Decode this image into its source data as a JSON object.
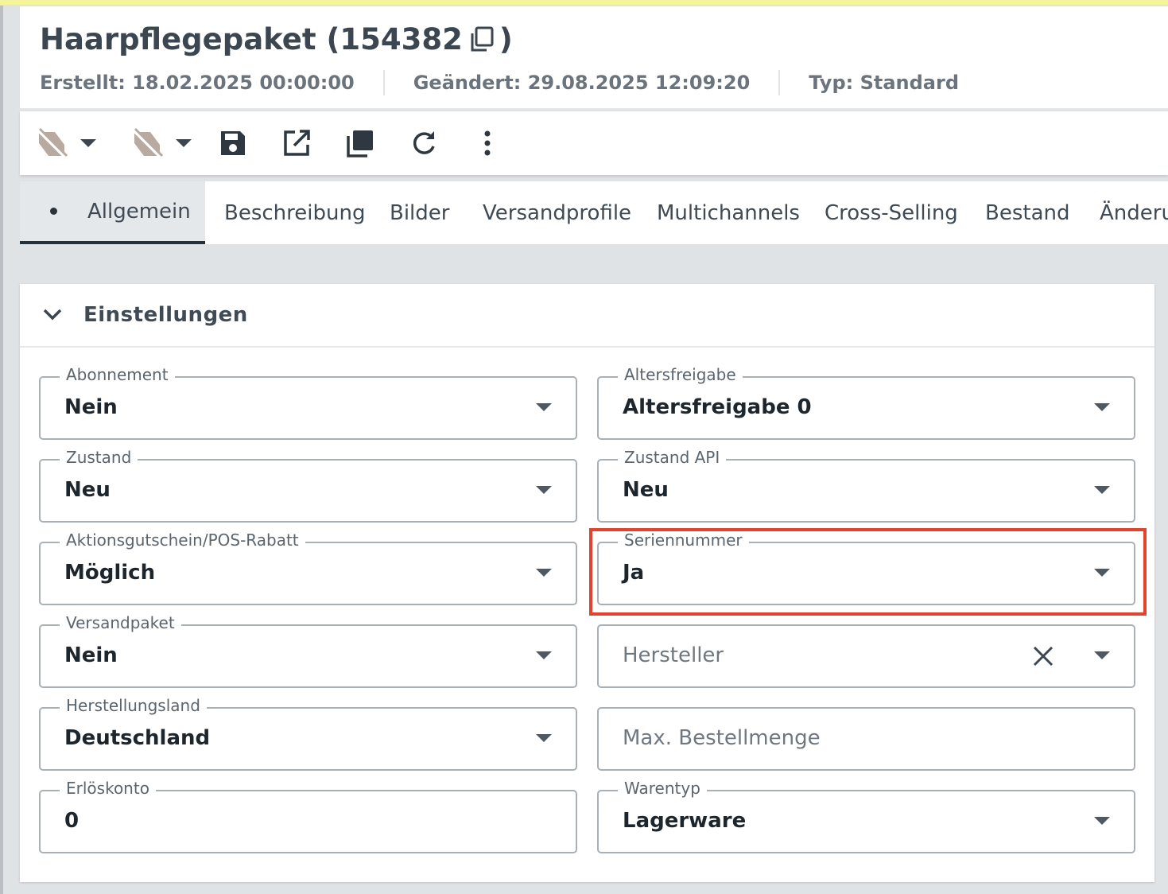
{
  "header": {
    "title": "Haarpflegepaket (154382",
    "title_close": ")",
    "created": "Erstellt: 18.02.2025 00:00:00",
    "modified": "Geändert: 29.08.2025 12:09:20",
    "type": "Typ: Standard"
  },
  "toolbar": {
    "icons": [
      "visibility-off-icon",
      "visibility-off-icon",
      "save-icon",
      "open-external-icon",
      "duplicate-icon",
      "refresh-icon",
      "more-vertical-icon"
    ]
  },
  "tabs": [
    {
      "label": "Allgemein",
      "active": true
    },
    {
      "label": "Beschreibung"
    },
    {
      "label": "Bilder"
    },
    {
      "label": "Versandprofile"
    },
    {
      "label": "Multichannels"
    },
    {
      "label": "Cross-Selling"
    },
    {
      "label": "Bestand"
    },
    {
      "label": "Änderu"
    }
  ],
  "section": {
    "title": "Einstellungen"
  },
  "fields": {
    "abonnement": {
      "label": "Abonnement",
      "value": "Nein"
    },
    "altersfreigabe": {
      "label": "Altersfreigabe",
      "value": "Altersfreigabe 0"
    },
    "zustand": {
      "label": "Zustand",
      "value": "Neu"
    },
    "zustand_api": {
      "label": "Zustand API",
      "value": "Neu"
    },
    "aktionsgutschein": {
      "label": "Aktionsgutschein/POS-Rabatt",
      "value": "Möglich"
    },
    "seriennummer": {
      "label": "Seriennummer",
      "value": "Ja"
    },
    "versandpaket": {
      "label": "Versandpaket",
      "value": "Nein"
    },
    "hersteller": {
      "placeholder": "Hersteller"
    },
    "herstellungsland": {
      "label": "Herstellungsland",
      "value": "Deutschland"
    },
    "max_bestellmenge": {
      "placeholder": "Max. Bestellmenge"
    },
    "erloeskonto": {
      "label": "Erlöskonto",
      "value": "0"
    },
    "warentyp": {
      "label": "Warentyp",
      "value": "Lagerware"
    }
  },
  "colors": {
    "highlight": "#e2432e",
    "icon_muted": "#b8aaa0",
    "icon_dark": "#2f3840"
  }
}
